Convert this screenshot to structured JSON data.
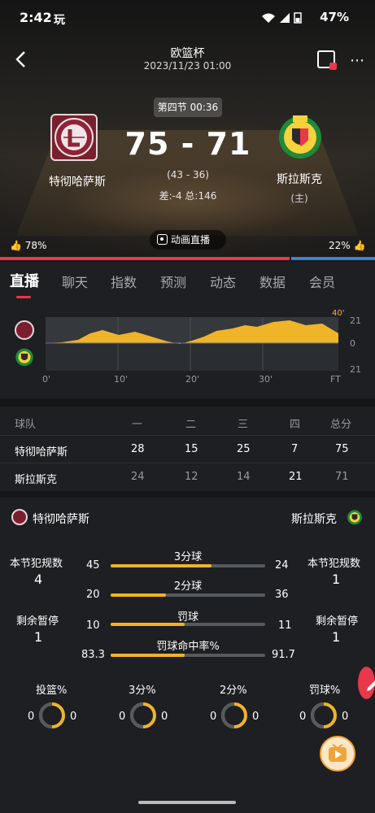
{
  "status_bar": {
    "time": "2:42",
    "carrier_icon": "玩",
    "battery": "47%"
  },
  "header": {
    "league": "欧篮杯",
    "datetime": "2023/11/23 01:00",
    "period_time": "第四节 00:36",
    "score": "75 - 71",
    "half_score": "(43 - 36)",
    "diff_total": "差:-4 总:146",
    "live_anim_label": "动画直播"
  },
  "home_team": {
    "name": "特彻哈萨斯",
    "logo_text": "BC LIETKABELIS",
    "logo_sub": "PANEVEZYS",
    "vote": "78%",
    "color": "#7b1f2e"
  },
  "away_team": {
    "name": "斯拉斯克",
    "tag": "(主)",
    "vote": "22%",
    "color": "#1f8a3a"
  },
  "tabs": [
    {
      "label": "直播",
      "active": true
    },
    {
      "label": "聊天"
    },
    {
      "label": "指数"
    },
    {
      "label": "预测"
    },
    {
      "label": "动态"
    },
    {
      "label": "数据"
    },
    {
      "label": "会员"
    }
  ],
  "momentum": {
    "corner_label": "40'",
    "y_labels": [
      "21",
      "0",
      "21"
    ],
    "x_labels": [
      "0'",
      "10'",
      "20'",
      "30'",
      "FT"
    ]
  },
  "quarter_table": {
    "headers": [
      "球队",
      "一",
      "二",
      "三",
      "四",
      "总分"
    ],
    "rows": [
      {
        "team": "特彻哈萨斯",
        "q": [
          "28",
          "15",
          "25",
          "7"
        ],
        "total": "75"
      },
      {
        "team": "斯拉斯克",
        "q": [
          "24",
          "12",
          "14",
          "21"
        ],
        "total": "71"
      }
    ]
  },
  "stats": {
    "home_name": "特彻哈萨斯",
    "away_name": "斯拉斯克",
    "left_fouls_label": "本节犯规数",
    "left_fouls": "4",
    "right_fouls_label": "本节犯规数",
    "right_fouls": "1",
    "left_timeouts_label": "剩余暂停",
    "left_timeouts": "1",
    "right_timeouts_label": "剩余暂停",
    "right_timeouts": "1",
    "bars": [
      {
        "label": "3分球",
        "home": "45",
        "away": "24",
        "home_frac": 0.65
      },
      {
        "label": "2分球",
        "home": "20",
        "away": "36",
        "home_frac": 0.36
      },
      {
        "label": "罚球",
        "home": "10",
        "away": "11",
        "home_frac": 0.48
      },
      {
        "label": "罚球命中率%",
        "home": "83.3",
        "away": "91.7",
        "home_frac": 0.48
      }
    ],
    "donuts": [
      {
        "label": "投篮%",
        "home": "0",
        "away": "0"
      },
      {
        "label": "3分%",
        "home": "0",
        "away": "0"
      },
      {
        "label": "2分%",
        "home": "0",
        "away": "0"
      },
      {
        "label": "罚球%",
        "home": "0",
        "away": "0"
      }
    ]
  }
}
